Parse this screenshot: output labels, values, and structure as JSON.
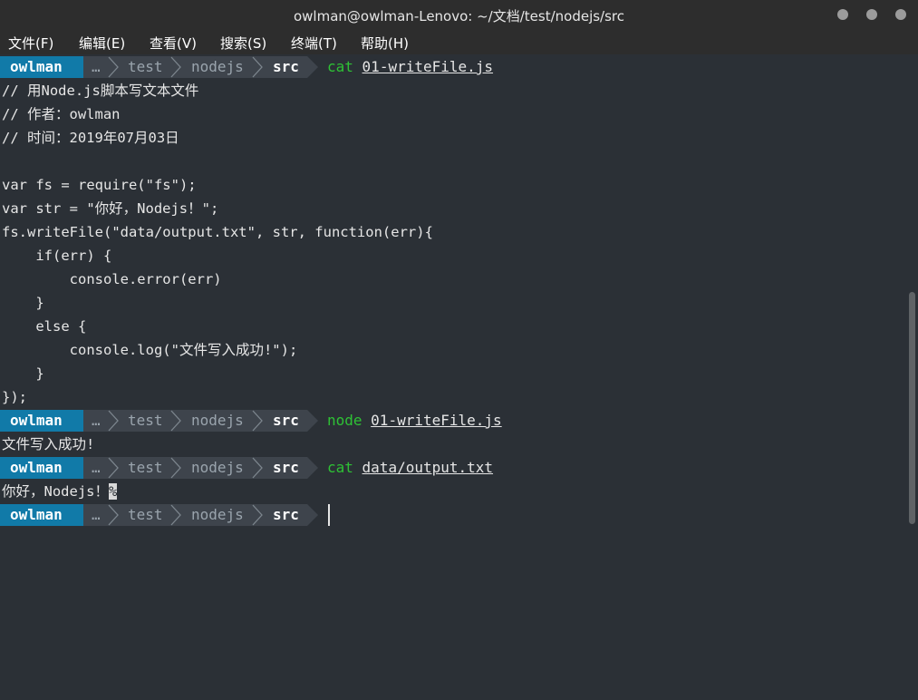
{
  "window": {
    "title": "owlman@owlman-Lenovo: ~/文档/test/nodejs/src"
  },
  "menu": [
    {
      "label": "文件(F)"
    },
    {
      "label": "编辑(E)"
    },
    {
      "label": "查看(V)"
    },
    {
      "label": "搜索(S)"
    },
    {
      "label": "终端(T)"
    },
    {
      "label": "帮助(H)"
    }
  ],
  "prompt": {
    "user": "owlman",
    "ellipsis": "…",
    "dir1": "test",
    "dir2": "nodejs",
    "dir3": "src"
  },
  "commands": [
    {
      "exe": "cat",
      "arg": "01-writeFile.js"
    },
    {
      "exe": "node",
      "arg": "01-writeFile.js"
    },
    {
      "exe": "cat",
      "arg": "data/output.txt"
    }
  ],
  "file_lines": [
    "// 用Node.js脚本写文本文件",
    "// 作者：owlman",
    "// 时间：2019年07月03日",
    "",
    "var fs = require(\"fs\");",
    "var str = \"你好，Nodejs！\";",
    "fs.writeFile(\"data/output.txt\", str, function(err){",
    "    if(err) {",
    "        console.error(err)",
    "    }",
    "    else {",
    "        console.log(\"文件写入成功!\");",
    "    }",
    "});"
  ],
  "node_output": "文件写入成功!",
  "cat_output": "你好，Nodejs！",
  "no_newline_mark": "%",
  "colors": {
    "background": "#2b3036",
    "user_segment": "#117aa8",
    "path_segment": "#3e444c",
    "command": "#2ec135"
  }
}
